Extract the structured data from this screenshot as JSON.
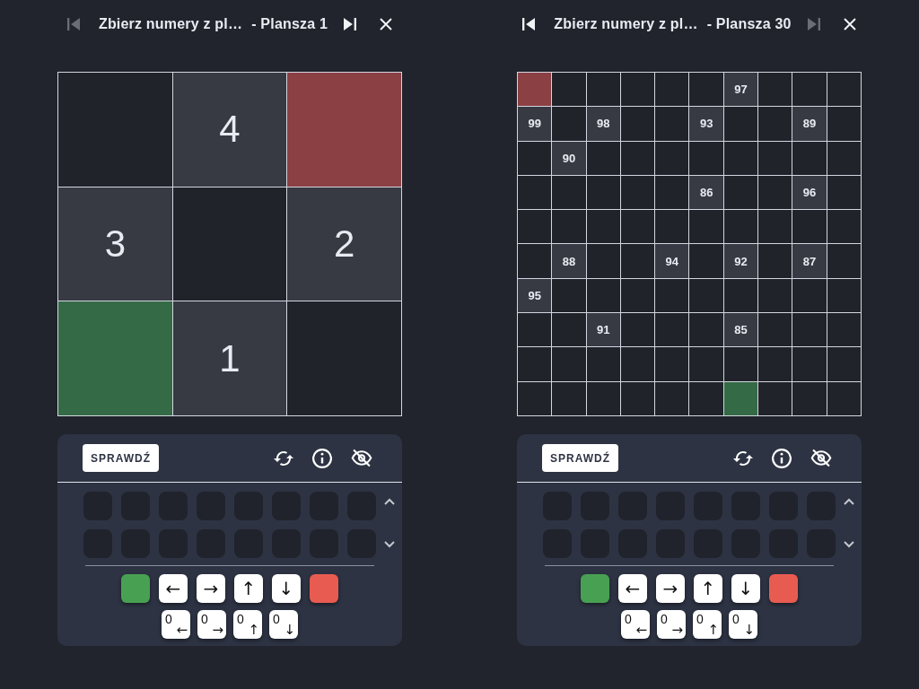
{
  "boards": [
    {
      "header": {
        "previous": {
          "disabled": true
        },
        "title": "Zbierz numery z pl…",
        "subtitle": "- Plansza 1",
        "next": {
          "disabled": false
        }
      },
      "grid": [
        [
          {
            "kind": "empty"
          },
          {
            "kind": "number",
            "text": "4"
          },
          {
            "kind": "fill",
            "color": "#8b4044"
          }
        ],
        [
          {
            "kind": "number",
            "text": "3"
          },
          {
            "kind": "empty"
          },
          {
            "kind": "number",
            "text": "2"
          }
        ],
        [
          {
            "kind": "fill",
            "color": "#346a45"
          },
          {
            "kind": "number",
            "text": "1"
          },
          {
            "kind": "empty"
          }
        ]
      ],
      "controls": {
        "check_button": "SPRAWDŹ",
        "slots": [
          [
            {
              "kind": "empty"
            },
            {
              "kind": "empty"
            },
            {
              "kind": "empty"
            },
            {
              "kind": "empty"
            },
            {
              "kind": "empty"
            },
            {
              "kind": "empty"
            },
            {
              "kind": "empty"
            },
            {
              "kind": "empty"
            }
          ],
          [
            {
              "kind": "empty"
            },
            {
              "kind": "empty"
            },
            {
              "kind": "empty"
            },
            {
              "kind": "empty"
            },
            {
              "kind": "empty"
            },
            {
              "kind": "empty"
            },
            {
              "kind": "empty"
            },
            {
              "kind": "empty"
            }
          ]
        ],
        "commands": [
          {
            "kind": "color",
            "color": "#48a152"
          },
          {
            "kind": "arrow",
            "label": "←"
          },
          {
            "kind": "arrow",
            "label": "→"
          },
          {
            "kind": "arrow",
            "label": "↑"
          },
          {
            "kind": "arrow",
            "label": "↓"
          },
          {
            "kind": "color",
            "color": "#e85b51"
          }
        ],
        "counters": [
          {
            "kind": "counter",
            "count": "0",
            "arrow": "←"
          },
          {
            "kind": "counter",
            "count": "0",
            "arrow": "→"
          },
          {
            "kind": "counter",
            "count": "0",
            "arrow": "↑"
          },
          {
            "kind": "counter",
            "count": "0",
            "arrow": "↓"
          }
        ]
      }
    },
    {
      "header": {
        "previous": {
          "disabled": false
        },
        "title": "Zbierz numery z pl…",
        "subtitle": "- Plansza 30",
        "next": {
          "disabled": true
        }
      },
      "grid": [
        [
          {
            "kind": "fill",
            "color": "#8b4044"
          },
          {
            "kind": "empty"
          },
          {
            "kind": "empty"
          },
          {
            "kind": "empty"
          },
          {
            "kind": "empty"
          },
          {
            "kind": "empty"
          },
          {
            "kind": "number",
            "text": "97"
          },
          {
            "kind": "empty"
          },
          {
            "kind": "empty"
          },
          {
            "kind": "empty"
          }
        ],
        [
          {
            "kind": "number",
            "text": "99"
          },
          {
            "kind": "empty"
          },
          {
            "kind": "number",
            "text": "98"
          },
          {
            "kind": "empty"
          },
          {
            "kind": "empty"
          },
          {
            "kind": "number",
            "text": "93"
          },
          {
            "kind": "empty"
          },
          {
            "kind": "empty"
          },
          {
            "kind": "number",
            "text": "89"
          },
          {
            "kind": "empty"
          }
        ],
        [
          {
            "kind": "empty"
          },
          {
            "kind": "number",
            "text": "90"
          },
          {
            "kind": "empty"
          },
          {
            "kind": "empty"
          },
          {
            "kind": "empty"
          },
          {
            "kind": "empty"
          },
          {
            "kind": "empty"
          },
          {
            "kind": "empty"
          },
          {
            "kind": "empty"
          },
          {
            "kind": "empty"
          }
        ],
        [
          {
            "kind": "empty"
          },
          {
            "kind": "empty"
          },
          {
            "kind": "empty"
          },
          {
            "kind": "empty"
          },
          {
            "kind": "empty"
          },
          {
            "kind": "number",
            "text": "86"
          },
          {
            "kind": "empty"
          },
          {
            "kind": "empty"
          },
          {
            "kind": "number",
            "text": "96"
          },
          {
            "kind": "empty"
          }
        ],
        [
          {
            "kind": "empty"
          },
          {
            "kind": "empty"
          },
          {
            "kind": "empty"
          },
          {
            "kind": "empty"
          },
          {
            "kind": "empty"
          },
          {
            "kind": "empty"
          },
          {
            "kind": "empty"
          },
          {
            "kind": "empty"
          },
          {
            "kind": "empty"
          },
          {
            "kind": "empty"
          }
        ],
        [
          {
            "kind": "empty"
          },
          {
            "kind": "number",
            "text": "88"
          },
          {
            "kind": "empty"
          },
          {
            "kind": "empty"
          },
          {
            "kind": "number",
            "text": "94"
          },
          {
            "kind": "empty"
          },
          {
            "kind": "number",
            "text": "92"
          },
          {
            "kind": "empty"
          },
          {
            "kind": "number",
            "text": "87"
          },
          {
            "kind": "empty"
          }
        ],
        [
          {
            "kind": "number",
            "text": "95"
          },
          {
            "kind": "empty"
          },
          {
            "kind": "empty"
          },
          {
            "kind": "empty"
          },
          {
            "kind": "empty"
          },
          {
            "kind": "empty"
          },
          {
            "kind": "empty"
          },
          {
            "kind": "empty"
          },
          {
            "kind": "empty"
          },
          {
            "kind": "empty"
          }
        ],
        [
          {
            "kind": "empty"
          },
          {
            "kind": "empty"
          },
          {
            "kind": "number",
            "text": "91"
          },
          {
            "kind": "empty"
          },
          {
            "kind": "empty"
          },
          {
            "kind": "empty"
          },
          {
            "kind": "number",
            "text": "85"
          },
          {
            "kind": "empty"
          },
          {
            "kind": "empty"
          },
          {
            "kind": "empty"
          }
        ],
        [
          {
            "kind": "empty"
          },
          {
            "kind": "empty"
          },
          {
            "kind": "empty"
          },
          {
            "kind": "empty"
          },
          {
            "kind": "empty"
          },
          {
            "kind": "empty"
          },
          {
            "kind": "empty"
          },
          {
            "kind": "empty"
          },
          {
            "kind": "empty"
          },
          {
            "kind": "empty"
          }
        ],
        [
          {
            "kind": "empty"
          },
          {
            "kind": "empty"
          },
          {
            "kind": "empty"
          },
          {
            "kind": "empty"
          },
          {
            "kind": "empty"
          },
          {
            "kind": "empty"
          },
          {
            "kind": "fill",
            "color": "#346a45"
          },
          {
            "kind": "empty"
          },
          {
            "kind": "empty"
          },
          {
            "kind": "empty"
          }
        ]
      ],
      "controls": {
        "check_button": "SPRAWDŹ",
        "slots": [
          [
            {
              "kind": "empty"
            },
            {
              "kind": "empty"
            },
            {
              "kind": "empty"
            },
            {
              "kind": "empty"
            },
            {
              "kind": "empty"
            },
            {
              "kind": "empty"
            },
            {
              "kind": "empty"
            },
            {
              "kind": "empty"
            }
          ],
          [
            {
              "kind": "empty"
            },
            {
              "kind": "empty"
            },
            {
              "kind": "empty"
            },
            {
              "kind": "empty"
            },
            {
              "kind": "empty"
            },
            {
              "kind": "empty"
            },
            {
              "kind": "empty"
            },
            {
              "kind": "empty"
            }
          ]
        ],
        "commands": [
          {
            "kind": "color",
            "color": "#48a152"
          },
          {
            "kind": "arrow",
            "label": "←"
          },
          {
            "kind": "arrow",
            "label": "→"
          },
          {
            "kind": "arrow",
            "label": "↑"
          },
          {
            "kind": "arrow",
            "label": "↓"
          },
          {
            "kind": "color",
            "color": "#e85b51"
          }
        ],
        "counters": [
          {
            "kind": "counter",
            "count": "0",
            "arrow": "←"
          },
          {
            "kind": "counter",
            "count": "0",
            "arrow": "→"
          },
          {
            "kind": "counter",
            "count": "0",
            "arrow": "↑"
          },
          {
            "kind": "counter",
            "count": "0",
            "arrow": "↓"
          }
        ]
      }
    }
  ]
}
